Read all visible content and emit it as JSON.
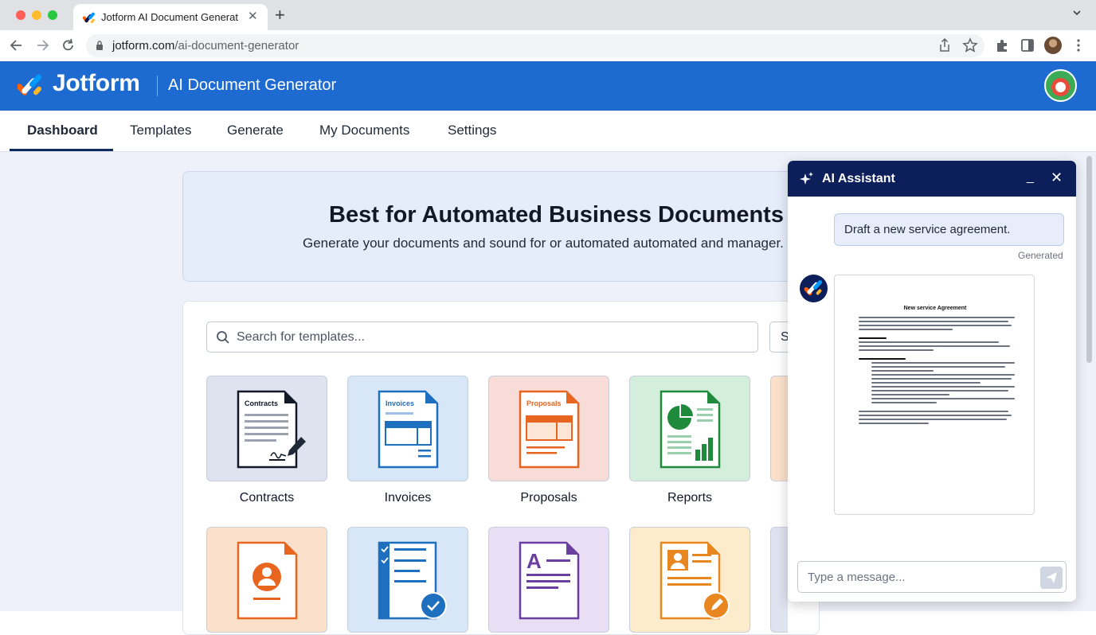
{
  "browser": {
    "tab_title": "Jotform AI Document Generator",
    "tab_close": "✕",
    "new_tab": "+",
    "url_domain": "jotform.com",
    "url_path": "/ai-document-generator",
    "colors": {
      "close": "#ff5f57",
      "minimize": "#febc2e",
      "maximize": "#28c840"
    }
  },
  "header": {
    "brand": "Jotform",
    "product": "AI Document Generator"
  },
  "nav": {
    "items": [
      {
        "label": "Dashboard",
        "active": true
      },
      {
        "label": "Templates"
      },
      {
        "label": "Generate"
      },
      {
        "label": "My Documents"
      },
      {
        "label": "Settings"
      }
    ]
  },
  "hero": {
    "title": "Best for Automated Business Documents",
    "subtitle": "Generate your documents and sound for or automated automated and manager."
  },
  "search": {
    "placeholder": "Search for templates...",
    "side_button": "S"
  },
  "templates": [
    {
      "label": "Contracts",
      "doc_label": "Contracts",
      "color": "#1f2937",
      "bg": "#dfe2ef"
    },
    {
      "label": "Invoices",
      "doc_label": "Invoices",
      "color": "#1f6fbf",
      "bg": "#d8e7f7"
    },
    {
      "label": "Proposals",
      "doc_label": "Proposals",
      "color": "#e8651f",
      "bg": "#f8dcd8"
    },
    {
      "label": "Reports",
      "color": "#1f8a3c",
      "bg": "#d3efdc"
    },
    {
      "label": "",
      "color": "#e8651f",
      "bg": "#fbe0cc"
    },
    {
      "label": "",
      "color": "#1f6fbf",
      "bg": "#d8e7f7"
    },
    {
      "label": "",
      "color": "#6b3fa0",
      "bg": "#e9def3"
    },
    {
      "label": "",
      "color": "#e8861f",
      "bg": "#fdeccb"
    }
  ],
  "assistant": {
    "title": "AI Assistant",
    "minimize": "_",
    "close": "✕",
    "user_message": "Draft a new service agreement.",
    "status": "Generated",
    "doc_title": "New service Agreement",
    "input_placeholder": "Type a message..."
  }
}
